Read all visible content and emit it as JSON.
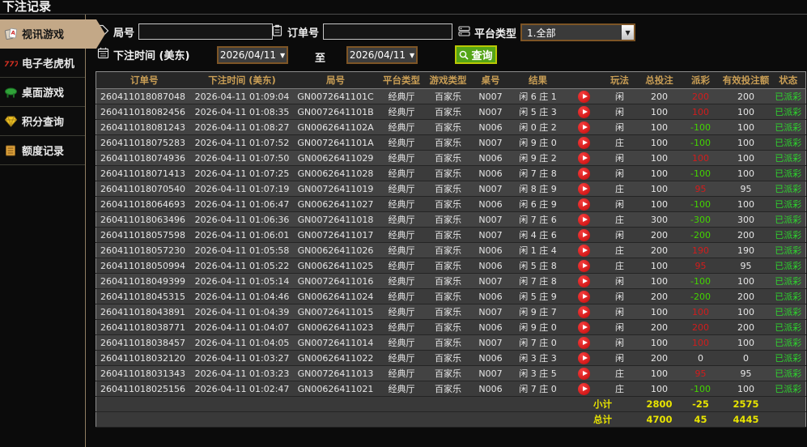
{
  "page_title": "下注记录",
  "sidebar": {
    "items": [
      {
        "id": "video-games",
        "label": "视讯游戏",
        "icon": "cards-icon",
        "active": true
      },
      {
        "id": "slots",
        "label": "电子老虎机",
        "icon": "slots-777-icon",
        "active": false
      },
      {
        "id": "table-games",
        "label": "桌面游戏",
        "icon": "table-games-icon",
        "active": false
      },
      {
        "id": "points-query",
        "label": "积分查询",
        "icon": "points-gem-icon",
        "active": false
      },
      {
        "id": "quota-records",
        "label": "额度记录",
        "icon": "quota-notes-icon",
        "active": false
      }
    ]
  },
  "filters": {
    "round_no_label": "局号",
    "round_no_value": "",
    "order_no_label": "订单号",
    "order_no_value": "",
    "platform_type_label": "平台类型",
    "platform_type_value": "1.全部",
    "bet_time_label": "下注时间 (美东)",
    "date_from": "2026/04/11",
    "to_label": "至",
    "date_to": "2026/04/11",
    "search_button_label": "查询"
  },
  "table": {
    "columns": [
      "订单号",
      "下注时间 (美东)",
      "局号",
      "平台类型",
      "游戏类型",
      "桌号",
      "结果",
      "",
      "玩法",
      "总投注",
      "派彩",
      "有效投注额",
      "状态"
    ],
    "rows": [
      {
        "order_no": "260411018087048",
        "bet_time": "2026-04-11 01:09:04",
        "round_no": "GN0072641101C",
        "platform": "经典厅",
        "game_type": "百家乐",
        "table_no": "N007",
        "result": "闲 6 庄 1",
        "play_type": "闲",
        "total_bet": "200",
        "payout": "200",
        "payout_color": "win",
        "valid_bet": "200",
        "status": "已派彩"
      },
      {
        "order_no": "260411018082456",
        "bet_time": "2026-04-11 01:08:35",
        "round_no": "GN0072641101B",
        "platform": "经典厅",
        "game_type": "百家乐",
        "table_no": "N007",
        "result": "闲 5 庄 3",
        "play_type": "闲",
        "total_bet": "100",
        "payout": "100",
        "payout_color": "win",
        "valid_bet": "100",
        "status": "已派彩"
      },
      {
        "order_no": "260411018081243",
        "bet_time": "2026-04-11 01:08:27",
        "round_no": "GN0062641102A",
        "platform": "经典厅",
        "game_type": "百家乐",
        "table_no": "N006",
        "result": "闲 0 庄 2",
        "play_type": "闲",
        "total_bet": "100",
        "payout": "-100",
        "payout_color": "loss",
        "valid_bet": "100",
        "status": "已派彩"
      },
      {
        "order_no": "260411018075283",
        "bet_time": "2026-04-11 01:07:52",
        "round_no": "GN0072641101A",
        "platform": "经典厅",
        "game_type": "百家乐",
        "table_no": "N007",
        "result": "闲 9 庄 0",
        "play_type": "庄",
        "total_bet": "100",
        "payout": "-100",
        "payout_color": "loss",
        "valid_bet": "100",
        "status": "已派彩"
      },
      {
        "order_no": "260411018074936",
        "bet_time": "2026-04-11 01:07:50",
        "round_no": "GN00626411029",
        "platform": "经典厅",
        "game_type": "百家乐",
        "table_no": "N006",
        "result": "闲 9 庄 2",
        "play_type": "闲",
        "total_bet": "100",
        "payout": "100",
        "payout_color": "win",
        "valid_bet": "100",
        "status": "已派彩"
      },
      {
        "order_no": "260411018071413",
        "bet_time": "2026-04-11 01:07:25",
        "round_no": "GN00626411028",
        "platform": "经典厅",
        "game_type": "百家乐",
        "table_no": "N006",
        "result": "闲 7 庄 8",
        "play_type": "闲",
        "total_bet": "100",
        "payout": "-100",
        "payout_color": "loss",
        "valid_bet": "100",
        "status": "已派彩"
      },
      {
        "order_no": "260411018070540",
        "bet_time": "2026-04-11 01:07:19",
        "round_no": "GN00726411019",
        "platform": "经典厅",
        "game_type": "百家乐",
        "table_no": "N007",
        "result": "闲 8 庄 9",
        "play_type": "庄",
        "total_bet": "100",
        "payout": "95",
        "payout_color": "win",
        "valid_bet": "95",
        "status": "已派彩"
      },
      {
        "order_no": "260411018064693",
        "bet_time": "2026-04-11 01:06:47",
        "round_no": "GN00626411027",
        "platform": "经典厅",
        "game_type": "百家乐",
        "table_no": "N006",
        "result": "闲 6 庄 9",
        "play_type": "闲",
        "total_bet": "100",
        "payout": "-100",
        "payout_color": "loss",
        "valid_bet": "100",
        "status": "已派彩"
      },
      {
        "order_no": "260411018063496",
        "bet_time": "2026-04-11 01:06:36",
        "round_no": "GN00726411018",
        "platform": "经典厅",
        "game_type": "百家乐",
        "table_no": "N007",
        "result": "闲 7 庄 6",
        "play_type": "庄",
        "total_bet": "300",
        "payout": "-300",
        "payout_color": "loss",
        "valid_bet": "300",
        "status": "已派彩"
      },
      {
        "order_no": "260411018057598",
        "bet_time": "2026-04-11 01:06:01",
        "round_no": "GN00726411017",
        "platform": "经典厅",
        "game_type": "百家乐",
        "table_no": "N007",
        "result": "闲 4 庄 6",
        "play_type": "闲",
        "total_bet": "200",
        "payout": "-200",
        "payout_color": "loss",
        "valid_bet": "200",
        "status": "已派彩"
      },
      {
        "order_no": "260411018057230",
        "bet_time": "2026-04-11 01:05:58",
        "round_no": "GN00626411026",
        "platform": "经典厅",
        "game_type": "百家乐",
        "table_no": "N006",
        "result": "闲 1 庄 4",
        "play_type": "庄",
        "total_bet": "200",
        "payout": "190",
        "payout_color": "win",
        "valid_bet": "190",
        "status": "已派彩"
      },
      {
        "order_no": "260411018050994",
        "bet_time": "2026-04-11 01:05:22",
        "round_no": "GN00626411025",
        "platform": "经典厅",
        "game_type": "百家乐",
        "table_no": "N006",
        "result": "闲 5 庄 8",
        "play_type": "庄",
        "total_bet": "100",
        "payout": "95",
        "payout_color": "win",
        "valid_bet": "95",
        "status": "已派彩"
      },
      {
        "order_no": "260411018049399",
        "bet_time": "2026-04-11 01:05:14",
        "round_no": "GN00726411016",
        "platform": "经典厅",
        "game_type": "百家乐",
        "table_no": "N007",
        "result": "闲 7 庄 8",
        "play_type": "闲",
        "total_bet": "100",
        "payout": "-100",
        "payout_color": "loss",
        "valid_bet": "100",
        "status": "已派彩"
      },
      {
        "order_no": "260411018045315",
        "bet_time": "2026-04-11 01:04:46",
        "round_no": "GN00626411024",
        "platform": "经典厅",
        "game_type": "百家乐",
        "table_no": "N006",
        "result": "闲 5 庄 9",
        "play_type": "闲",
        "total_bet": "200",
        "payout": "-200",
        "payout_color": "loss",
        "valid_bet": "200",
        "status": "已派彩"
      },
      {
        "order_no": "260411018043891",
        "bet_time": "2026-04-11 01:04:39",
        "round_no": "GN00726411015",
        "platform": "经典厅",
        "game_type": "百家乐",
        "table_no": "N007",
        "result": "闲 9 庄 7",
        "play_type": "闲",
        "total_bet": "100",
        "payout": "100",
        "payout_color": "win",
        "valid_bet": "100",
        "status": "已派彩"
      },
      {
        "order_no": "260411018038771",
        "bet_time": "2026-04-11 01:04:07",
        "round_no": "GN00626411023",
        "platform": "经典厅",
        "game_type": "百家乐",
        "table_no": "N006",
        "result": "闲 9 庄 0",
        "play_type": "闲",
        "total_bet": "200",
        "payout": "200",
        "payout_color": "win",
        "valid_bet": "200",
        "status": "已派彩"
      },
      {
        "order_no": "260411018038457",
        "bet_time": "2026-04-11 01:04:05",
        "round_no": "GN00726411014",
        "platform": "经典厅",
        "game_type": "百家乐",
        "table_no": "N007",
        "result": "闲 7 庄 0",
        "play_type": "闲",
        "total_bet": "100",
        "payout": "100",
        "payout_color": "win",
        "valid_bet": "100",
        "status": "已派彩"
      },
      {
        "order_no": "260411018032120",
        "bet_time": "2026-04-11 01:03:27",
        "round_no": "GN00626411022",
        "platform": "经典厅",
        "game_type": "百家乐",
        "table_no": "N006",
        "result": "闲 3 庄 3",
        "play_type": "闲",
        "total_bet": "200",
        "payout": "0",
        "payout_color": "neutral",
        "valid_bet": "0",
        "status": "已派彩"
      },
      {
        "order_no": "260411018031343",
        "bet_time": "2026-04-11 01:03:23",
        "round_no": "GN00726411013",
        "platform": "经典厅",
        "game_type": "百家乐",
        "table_no": "N007",
        "result": "闲 3 庄 5",
        "play_type": "庄",
        "total_bet": "100",
        "payout": "95",
        "payout_color": "win",
        "valid_bet": "95",
        "status": "已派彩"
      },
      {
        "order_no": "260411018025156",
        "bet_time": "2026-04-11 01:02:47",
        "round_no": "GN00626411021",
        "platform": "经典厅",
        "game_type": "百家乐",
        "table_no": "N006",
        "result": "闲 7 庄 0",
        "play_type": "庄",
        "total_bet": "100",
        "payout": "-100",
        "payout_color": "loss",
        "valid_bet": "100",
        "status": "已派彩"
      }
    ],
    "subtotal": {
      "label": "小计",
      "total_bet": "2800",
      "payout": "-25",
      "valid_bet": "2575"
    },
    "grand_total": {
      "label": "总计",
      "total_bet": "4700",
      "payout": "45",
      "valid_bet": "4445"
    }
  },
  "colors": {
    "active_menu_tan": "#c3a887",
    "header_gold": "#c99e55",
    "payout_win_red": "#d21c1c",
    "payout_loss_green": "#43d400",
    "status_green": "#2ed52e",
    "summary_yellow": "#e8e400",
    "search_button_green": "#55a517",
    "picker_border_brown": "#7d5526"
  }
}
